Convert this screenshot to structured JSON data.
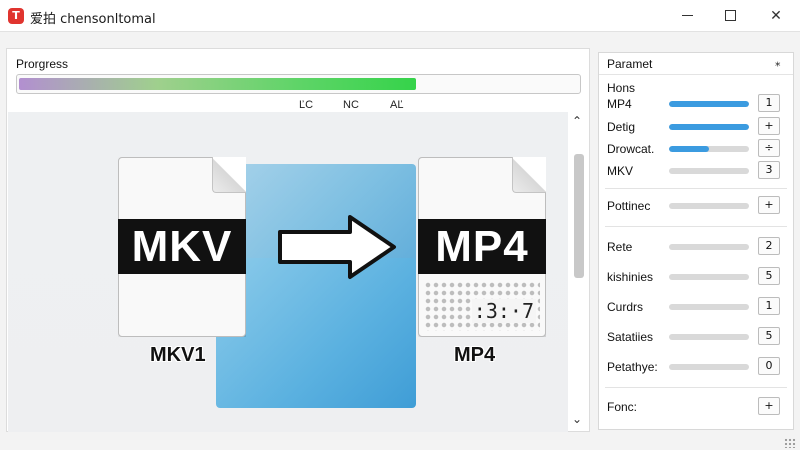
{
  "window": {
    "app_logo_glyph": "T",
    "title": "爱拍 chensonltomal",
    "minimize_label": "",
    "maximize_label": "",
    "close_label": "✕"
  },
  "progress": {
    "label": "Prorgress",
    "value_fraction": 0.71,
    "markers": [
      "ĽC",
      "NC",
      "AĽ"
    ]
  },
  "conversion": {
    "source_format": "MKV",
    "target_format": "MP4",
    "source_caption": "MKV1",
    "target_caption": "MP4",
    "target_counter": ":3:·7"
  },
  "scroll": {
    "up_glyph": "⌃",
    "down_glyph": "⌄"
  },
  "params": {
    "title": "Paramet",
    "pin_glyph": "⁎",
    "group_label": "Hons",
    "rows": [
      {
        "label": "MP4",
        "level": 1.0,
        "value": "1"
      },
      {
        "label": "Detig",
        "level": 1.0,
        "value": "+"
      },
      {
        "label": "Drowcat.",
        "level": 0.5,
        "value": "÷"
      },
      {
        "label": "MKV",
        "level": 0.0,
        "value": "3"
      },
      {
        "label": "Pottinec",
        "level": 0.0,
        "value": "+"
      },
      {
        "label": "Rete",
        "level": 0.0,
        "value": "2"
      },
      {
        "label": "kishinies",
        "level": 0.0,
        "value": "5"
      },
      {
        "label": "Curdrs",
        "level": 0.0,
        "value": "1"
      },
      {
        "label": "Satatiies",
        "level": 0.0,
        "value": "5"
      },
      {
        "label": "Petathye:",
        "level": 0.0,
        "value": "0"
      },
      {
        "label": "Fonc:",
        "level": null,
        "value": "+"
      }
    ]
  },
  "colors": {
    "accent": "#3b9be0",
    "progress_green": "#35d34a",
    "logo_red": "#e0342f"
  }
}
